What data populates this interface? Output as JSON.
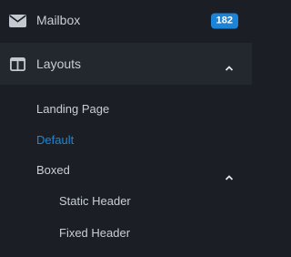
{
  "nav": {
    "mailbox": {
      "label": "Mailbox",
      "icon": "envelope-icon",
      "badge": "182"
    },
    "layouts": {
      "label": "Layouts",
      "icon": "columns-icon",
      "expanded": true,
      "children": {
        "landing": {
          "label": "Landing Page"
        },
        "default": {
          "label": "Default",
          "active": true
        },
        "boxed": {
          "label": "Boxed",
          "expanded": true,
          "children": {
            "static": {
              "label": "Static Header"
            },
            "fixed": {
              "label": "Fixed Header"
            }
          }
        }
      }
    }
  },
  "colors": {
    "background": "#1b1f25",
    "expanded_row": "#23272e",
    "text": "#c9ced6",
    "accent": "#1b87d8",
    "badge": "#1c83d6"
  }
}
